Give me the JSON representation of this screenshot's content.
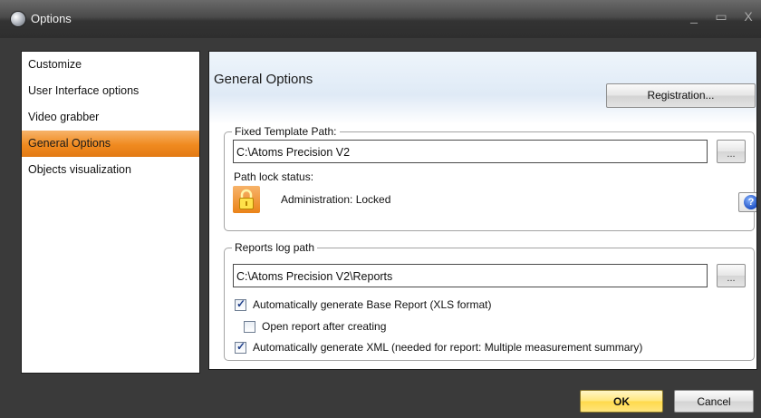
{
  "window": {
    "title": "Options",
    "controls": {
      "minimize": "_",
      "maximize": "▭",
      "close": "X"
    }
  },
  "sidebar": {
    "items": [
      {
        "label": "Customize"
      },
      {
        "label": "User Interface options"
      },
      {
        "label": "Video grabber"
      },
      {
        "label": "General Options",
        "selected": true
      },
      {
        "label": "Objects visualization"
      }
    ]
  },
  "main": {
    "title": "General Options",
    "registration_button": "Registration...",
    "fixed_template": {
      "label": "Fixed Template Path:",
      "path": "C:\\Atoms Precision V2",
      "browse": "...",
      "lock_label": "Path lock status:",
      "lock_status": "Administration: Locked",
      "help_icon": "?"
    },
    "reports": {
      "label": "Reports log path",
      "path": "C:\\Atoms Precision V2\\Reports",
      "browse": "...",
      "options": [
        {
          "label": "Automatically generate Base Report (XLS format)",
          "checked": true
        },
        {
          "label": "Open report after creating",
          "checked": false
        },
        {
          "label": "Automatically generate XML (needed for report: Multiple measurement summary)",
          "checked": true
        }
      ]
    }
  },
  "footer": {
    "ok": "OK",
    "cancel": "Cancel"
  },
  "colors": {
    "accent_orange": "#f08a1f",
    "ok_yellow": "#ffd94a",
    "titlebar": "#3a3a3a"
  }
}
